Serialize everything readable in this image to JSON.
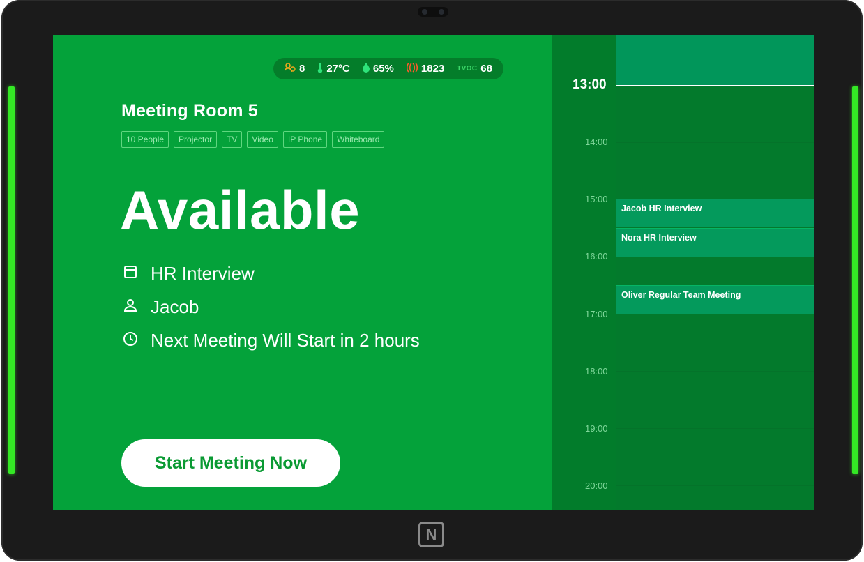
{
  "sensors": [
    {
      "icon": "occupancy-icon",
      "value": "8",
      "color": "#f0a81c"
    },
    {
      "icon": "thermometer-icon",
      "value": "27°C",
      "color": "#2ee37a"
    },
    {
      "icon": "humidity-drop-icon",
      "value": "65%",
      "color": "#2ee37a"
    },
    {
      "icon": "co2-icon",
      "value": "1823",
      "color": "#ff5a2a"
    },
    {
      "label": "TVOC",
      "value": "68",
      "color": "#3cd86a"
    }
  ],
  "room": {
    "title": "Meeting Room 5",
    "tags": [
      "10 People",
      "Projector",
      "TV",
      "Video",
      "IP Phone",
      "Whiteboard"
    ]
  },
  "status": "Available",
  "details": {
    "meeting_name": "HR Interview",
    "organizer": "Jacob",
    "next_meeting": "Next Meeting Will  Start in 2 hours"
  },
  "start_button_label": "Start Meeting Now",
  "calendar": {
    "current_time": "13:00",
    "hours": [
      "14:00",
      "15:00",
      "16:00",
      "17:00",
      "18:00",
      "19:00",
      "20:00"
    ],
    "events": [
      {
        "label": "Jacob  HR Interview"
      },
      {
        "label": "Nora  HR Interview"
      },
      {
        "label": "Oliver  Regular Team Meeting"
      }
    ]
  },
  "colors": {
    "available_green": "#04a23a",
    "calendar_green": "#038530",
    "event_green": "#049a5c",
    "led_green": "#34e825"
  },
  "device": {
    "nfc_icon": "nfc-icon"
  }
}
